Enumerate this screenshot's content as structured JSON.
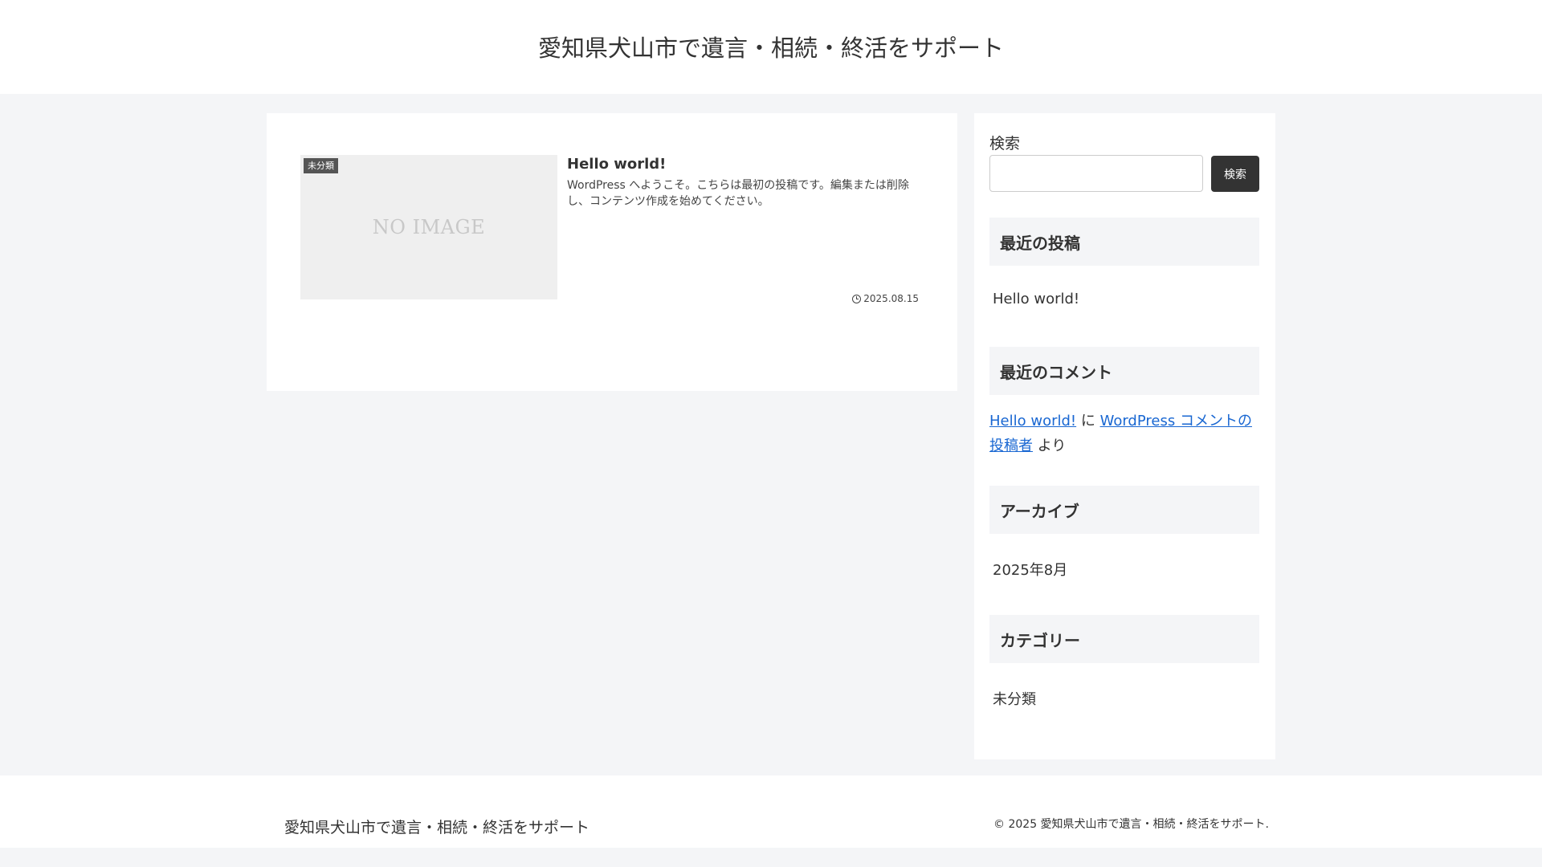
{
  "header": {
    "site_title": "愛知県犬山市で遺言・相続・終活をサポート"
  },
  "post": {
    "category": "未分類",
    "thumbnail_text": "NO IMAGE",
    "title": "Hello world!",
    "snippet": "WordPress へようこそ。こちらは最初の投稿です。編集または削除し、コンテンツ作成を始めてください。",
    "date": "2025.08.15"
  },
  "sidebar": {
    "search_label": "検索",
    "search_value": "",
    "search_button": "検索",
    "recent_posts": {
      "heading": "最近の投稿",
      "items": [
        "Hello world!"
      ]
    },
    "recent_comments": {
      "heading": "最近のコメント",
      "post_link": "Hello world!",
      "connector": " に ",
      "author_link": "WordPress コメントの投稿者",
      "suffix": " より"
    },
    "archives": {
      "heading": "アーカイブ",
      "items": [
        "2025年8月"
      ]
    },
    "categories": {
      "heading": "カテゴリー",
      "items": [
        "未分類"
      ]
    }
  },
  "footer": {
    "site_title": "愛知県犬山市で遺言・相続・終活をサポート",
    "copyright": "© 2025 愛知県犬山市で遺言・相続・終活をサポート."
  },
  "colors": {
    "background": "#f4f5f7",
    "link": "#1967d2",
    "button": "#333333",
    "badge": "#555555"
  }
}
